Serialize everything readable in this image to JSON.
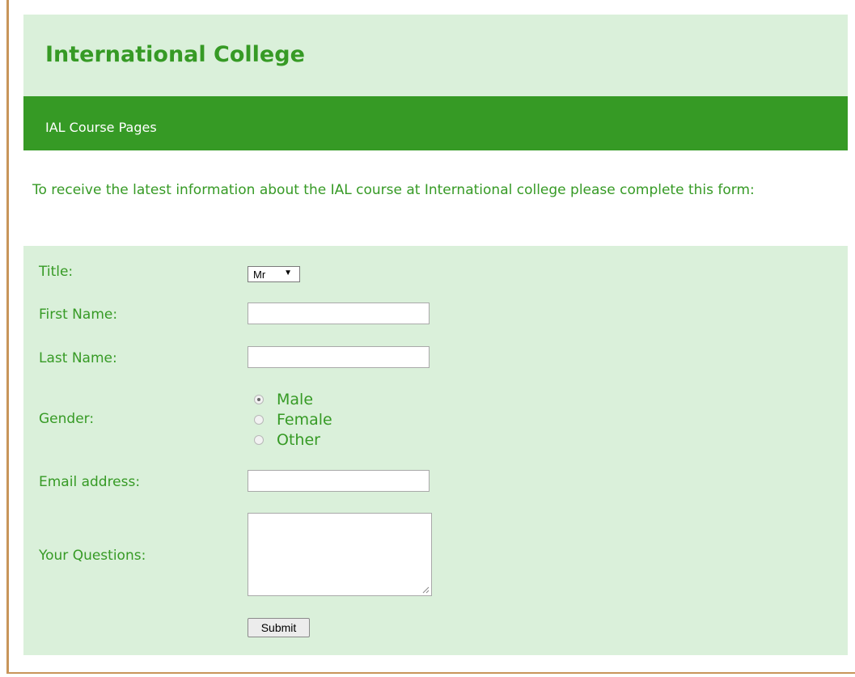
{
  "header": {
    "title": "International College"
  },
  "nav": {
    "link_label": "IAL Course Pages"
  },
  "intro": {
    "text": "To receive the latest information about the IAL course at International college please complete this form:"
  },
  "form": {
    "title_label": "Title:",
    "title_value": "Mr",
    "first_name_label": "First Name:",
    "first_name_value": "",
    "last_name_label": "Last Name:",
    "last_name_value": "",
    "gender_label": "Gender:",
    "gender_options": [
      {
        "label": "Male",
        "checked": true
      },
      {
        "label": "Female",
        "checked": false
      },
      {
        "label": "Other",
        "checked": false
      }
    ],
    "email_label": "Email address:",
    "email_value": "",
    "questions_label": "Your Questions:",
    "questions_value": "",
    "submit_label": "Submit"
  },
  "colors": {
    "brand_green": "#369a25",
    "panel_bg": "#daf0da",
    "frame_border": "#c8955a"
  },
  "icons": {
    "select_arrow": "dropdown-triangle-icon",
    "resize_grip": "resize-grip-icon"
  }
}
